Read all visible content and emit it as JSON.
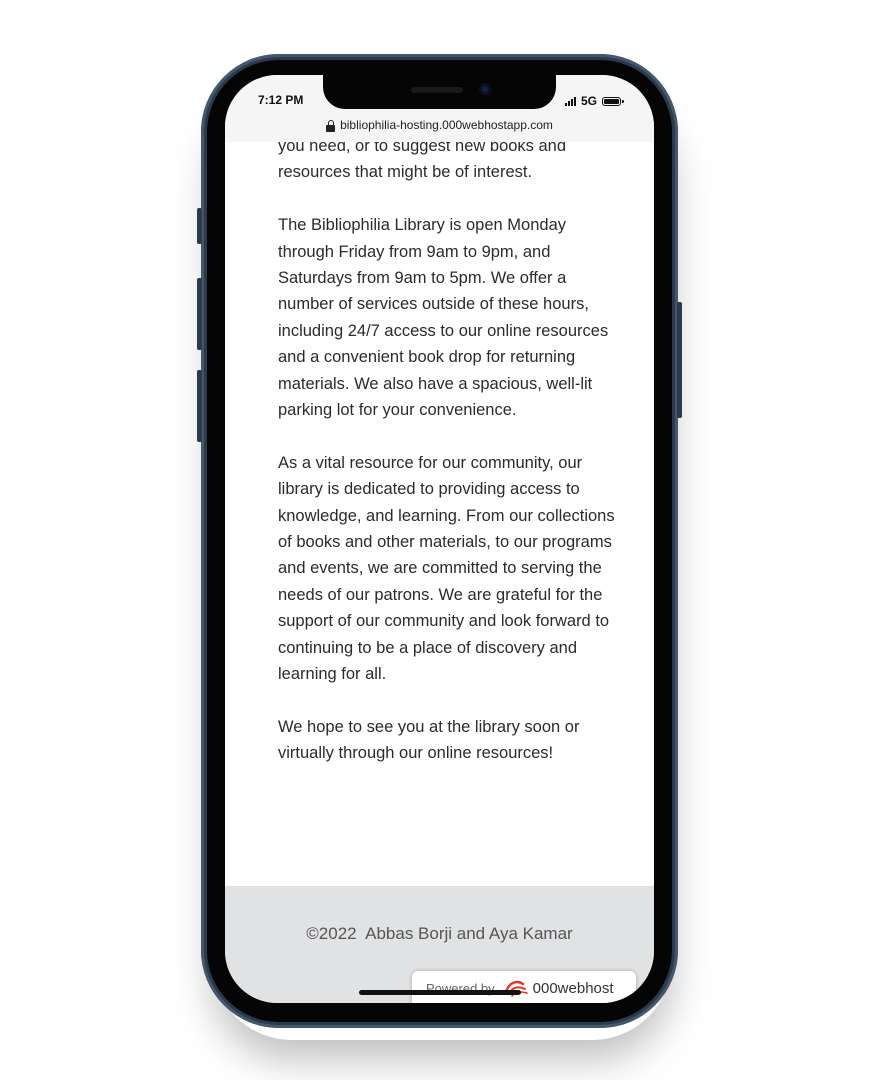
{
  "status_bar": {
    "time": "7:12 PM",
    "network": "5G",
    "signal_icon": "signal-bars-icon",
    "battery_icon": "battery-icon"
  },
  "browser": {
    "url": "bibliophilia-hosting.000webhostapp.com",
    "lock_icon": "lock-icon"
  },
  "article": {
    "paragraphs": [
      "you need, or to suggest new books and resources that might be of interest.",
      "The Bibliophilia Library is open Monday through Friday from 9am to 9pm, and Saturdays from 9am to 5pm. We offer a number of services outside of these hours, including 24/7 access to our online resources and a convenient book drop for returning materials. We also have a spacious, well-lit parking lot for your convenience.",
      "As a vital resource for our community, our library is dedicated to providing access to knowledge, and learning. From our collections of books and other materials, to our programs and events, we are committed to serving the needs of our patrons. We are grateful for the support of our community and look forward to continuing to be a place of discovery and learning for all.",
      "We hope to see you at the library soon or virtually through our online resources!"
    ]
  },
  "footer": {
    "copyright": "©2022  Abbas Borji and Aya Kamar"
  },
  "powered_badge": {
    "label": "Powered by",
    "brand": "000webhost",
    "logo_icon": "000webhost-logo-icon",
    "brand_color": "#e8342b"
  },
  "colors": {
    "page_background": "#ffffff",
    "text": "#2b2b2b",
    "footer_background": "#e1e2e4",
    "phone_frame": "#2a3a4a"
  }
}
